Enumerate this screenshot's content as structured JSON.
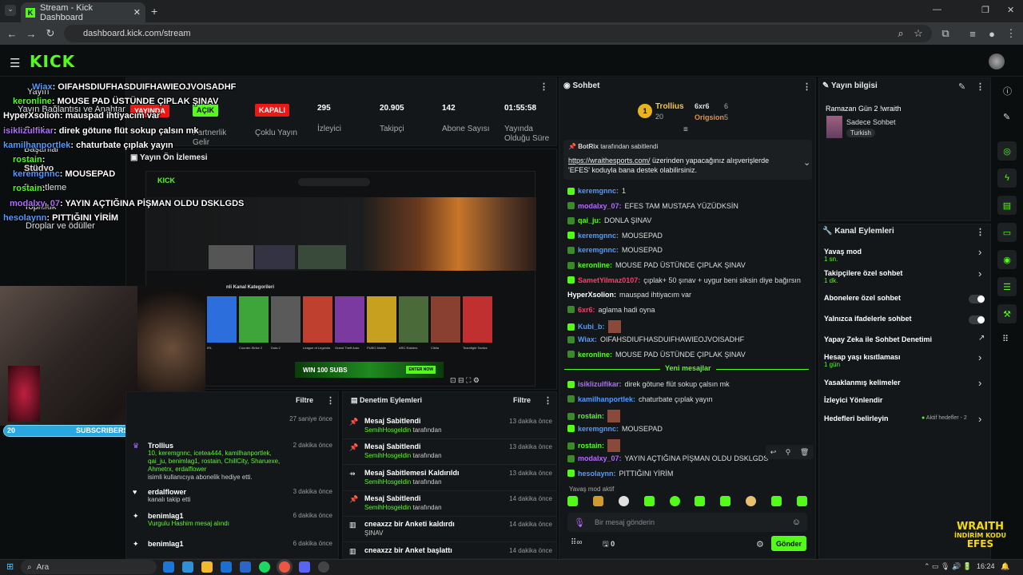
{
  "browser": {
    "tab_title": "Stream - Kick Dashboard",
    "url": "dashboard.kick.com/stream"
  },
  "header": {
    "logo": "KICK"
  },
  "sidebar": {
    "items": [
      "Yayın",
      "Yayın Bağlantısı ve Anahtarı",
      "Geliri",
      "Başarılar",
      "Stüdyo",
      "Denetleme",
      "Topluluk",
      "Droplar ve ödüller"
    ]
  },
  "stats": {
    "status_label": "YAYINDA",
    "items": [
      {
        "value": "AÇIK",
        "label": "Partnerlik Gelir Programı"
      },
      {
        "value": "KAPALI",
        "label": "Çoklu Yayın"
      },
      {
        "value": "295",
        "label": "İzleyici"
      },
      {
        "value": "20.905",
        "label": "Takipçi"
      },
      {
        "value": "142",
        "label": "Abone Sayısı"
      },
      {
        "value": "01:55:58",
        "label": "Yayında Olduğu Süre"
      }
    ]
  },
  "preview": {
    "title": "Yayın Ön İzlemesi",
    "banner": "WIN 100 SUBS",
    "banner_cta": "ENTER NOW",
    "categories_title": "nli Kanal Kategorileri",
    "categories": [
      "IRL",
      "Counter-Strike 2",
      "Dota 2",
      "League of Legends",
      "Grand Theft Auto",
      "PUBG Mobile",
      "ARC Raiders",
      "Ciblia",
      "Teamfight Tactics"
    ],
    "subs_bar": {
      "left": "20",
      "label": "SUBSCRIBERS",
      "right": "7",
      "progress": 0.74
    }
  },
  "overlay_chat": [
    {
      "user": "Wiax",
      "text": ": OIFAHSDIUFHASDUIFHAWIEOJVOISADHF"
    },
    {
      "user": "keronline",
      "text": ": MOUSE PAD ÜSTÜNDE ÇIPLAK ŞINAV"
    },
    {
      "user": "HyperXsolion",
      "text": ": mauspad ihtiyacım var"
    },
    {
      "user": "isiklizulfikar",
      "text": ": direk götune flüt sokup çalsın mk"
    },
    {
      "user": "kamilhanportlek",
      "text": ": chaturbate çıplak yayın"
    },
    {
      "user": "rostain",
      "text": ":"
    },
    {
      "user": "keremgnnc",
      "text": ": MOUSEPAD"
    },
    {
      "user": "rostain",
      "text": ":"
    },
    {
      "user": "modalxy_07",
      "text": ": YAYIN AÇTIĞINA PİŞMAN OLDU DSKLGDS"
    },
    {
      "user": "hesolaynn",
      "text": ": PITTIĞINI YİRİM"
    }
  ],
  "events": {
    "filter": "Filtre",
    "items": [
      {
        "title": "",
        "detail": "",
        "time": "27 saniye önce"
      },
      {
        "title": "Trollius",
        "detail": "10, keremgnnc, icetea444, kamilhanportlek, qai_ju, benimlag1, rostain, ChillCity, Sharuexe, Ahmetrx, erdalflower",
        "extra": "isimli kullanıcıya abonelik hediye etti.",
        "time": "2 dakika önce"
      },
      {
        "title": "erdalflower",
        "detail": "kanalı takip etti",
        "time": "3 dakika önce"
      },
      {
        "title": "benimlag1",
        "detail": "Vurgulu Hashim mesaj alındı",
        "time": "6 dakika önce"
      },
      {
        "title": "benimlag1",
        "detail": "",
        "time": "6 dakika önce"
      }
    ]
  },
  "moderation": {
    "title": "Denetim Eylemleri",
    "filter": "Filtre",
    "items": [
      {
        "title": "Mesaj Sabitlendi",
        "by": "SemihHosgeldin",
        "suffix": "tarafından",
        "time": "13 dakika önce"
      },
      {
        "title": "Mesaj Sabitlendi",
        "by": "SemihHosgeldin",
        "suffix": "tarafından",
        "time": "13 dakika önce"
      },
      {
        "title": "Mesaj Sabitlemesi Kaldırıldı",
        "by": "SemihHosgeldin",
        "suffix": "tarafından",
        "time": "13 dakika önce"
      },
      {
        "title": "Mesaj Sabitlendi",
        "by": "SemihHosgeldin",
        "suffix": "tarafından",
        "time": "14 dakika önce"
      },
      {
        "title": "cneaxzz bir Anketi kaldırdı",
        "by": "ŞINAV",
        "suffix": "",
        "time": "14 dakika önce"
      },
      {
        "title": "cneaxzz bir Anket başlattı",
        "by": "",
        "suffix": "",
        "time": "14 dakika önce"
      }
    ]
  },
  "chat": {
    "title": "Sohbet",
    "leaderboard": {
      "first": {
        "name": "Trollius",
        "count": "20",
        "rank": "1"
      },
      "second": {
        "name": "6xr6",
        "count": "6"
      },
      "third": {
        "name": "Origsion",
        "count": "5"
      }
    },
    "pinned": {
      "by": "BotRix",
      "by_suffix": "tarafından sabitlendi",
      "link": "https://wraithesports.com/",
      "text": " üzerinden yapacağınız alışverişlerde 'EFES' koduyla bana destek olabilirsiniz."
    },
    "messages": [
      {
        "user": "keremgnnc",
        "text": "1",
        "color": "#4f9bff"
      },
      {
        "user": "modalxy_07",
        "text": "EFES TAM MUSTAFA YÜZÜDKSİN",
        "color": "#b06bff"
      },
      {
        "user": "qai_ju",
        "text": "DONLA ŞINAV",
        "color": "#53fc18"
      },
      {
        "user": "keremgnnc",
        "text": "MOUSEPAD",
        "color": "#4f9bff"
      },
      {
        "user": "keremgnnc",
        "text": "MOUSEPAD",
        "color": "#4f9bff"
      },
      {
        "user": "keronline",
        "text": "MOUSE PAD ÜSTÜNDE ÇIPLAK ŞINAV",
        "color": "#53fc18"
      },
      {
        "user": "SametYilmaz0107",
        "text": "çıplak+ 50 şınav + uygur beni siksin diye bağırsın",
        "color": "#ff3b6b"
      },
      {
        "user": "HyperXsolion",
        "text": "mauspad ihtiyacım var",
        "color": "#ffffff"
      },
      {
        "user": "6xr6",
        "text": "aglama hadi oyna",
        "color": "#ff3b6b"
      },
      {
        "user": "Kubi_b",
        "text": "",
        "color": "#4f9bff"
      },
      {
        "user": "Wiax",
        "text": "OIFAHSDIUFHASDUIFHAWIEOJVOISADHF",
        "color": "#4f9bff"
      },
      {
        "user": "keronline",
        "text": "MOUSE PAD ÜSTÜNDE ÇIPLAK ŞINAV",
        "color": "#53fc18"
      }
    ],
    "new_messages_label": "Yeni mesajlar",
    "new_messages": [
      {
        "user": "isiklizulfikar",
        "text": "direk götune flüt sokup çalsın mk",
        "color": "#b06bff"
      },
      {
        "user": "kamilhanportlek",
        "text": "chaturbate çıplak yayın",
        "color": "#4f9bff"
      },
      {
        "user": "rostain",
        "text": "",
        "color": "#53fc18"
      },
      {
        "user": "keremgnnc",
        "text": "MOUSEPAD",
        "color": "#4f9bff"
      },
      {
        "user": "rostain",
        "text": "",
        "color": "#53fc18"
      },
      {
        "user": "modalxy_07",
        "text": "YAYIN AÇTIĞINA PİŞMAN OLDU DSKLGDS",
        "color": "#b06bff"
      },
      {
        "user": "hesolaynn",
        "text": "PITTIĞINI YİRİM",
        "color": "#4f9bff"
      }
    ],
    "slow_mode": "Yavaş mod aktif",
    "input_placeholder": "Bir mesaj gönderin",
    "send": "Gönder",
    "viewer_count": "0"
  },
  "stream_info": {
    "title": "Yayın bilgisi",
    "stream_title": "Ramazan Gün 2 !wraith",
    "category": "Sadece Sohbet",
    "tag": "Turkish"
  },
  "channel_actions": {
    "title": "Kanal Eylemleri",
    "items": [
      {
        "label": "Yavaş mod",
        "sub": "1 sn."
      },
      {
        "label": "Takipçilere özel sohbet",
        "sub": "1 dk."
      },
      {
        "label": "Abonelere özel sohbet",
        "sub": ""
      },
      {
        "label": "Yalnızca ifadelerle sohbet",
        "sub": ""
      },
      {
        "label": "Yapay Zeka ile Sohbet Denetimi",
        "sub": ""
      },
      {
        "label": "Hesap yaşı kısıtlaması",
        "sub": "1 gün"
      },
      {
        "label": "Yasaklanmış kelimeler",
        "sub": ""
      },
      {
        "label": "İzleyici Yönlendir",
        "sub": ""
      },
      {
        "label": "Hedefleri belirleyin",
        "sub": ""
      }
    ],
    "goals_status": "Aktif hedefler - 2"
  },
  "watermark": {
    "line1": "WRAITH",
    "line2": "İNDİRİM KODU",
    "line3": "EFES"
  },
  "taskbar": {
    "search": "Ara",
    "time": "16:24"
  }
}
